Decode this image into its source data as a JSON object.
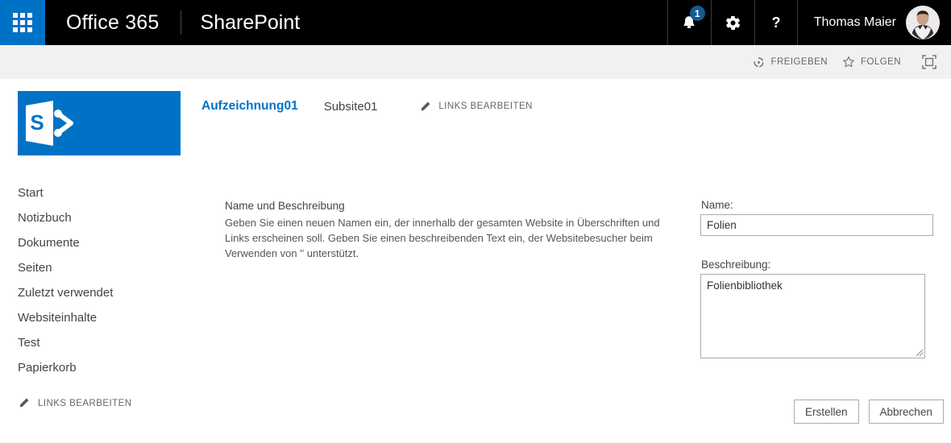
{
  "suitebar": {
    "waffle_label": "app-launcher",
    "brand": "Office 365",
    "app": "SharePoint",
    "notification_count": "1",
    "notification_icon": "bell-icon",
    "settings_icon": "gear-icon",
    "help_icon": "question-mark-icon",
    "user_name": "Thomas Maier",
    "background_color": "#000000",
    "waffle_color": "#0072C6"
  },
  "subbar": {
    "share_label": "FREIGEBEN",
    "follow_label": "FOLGEN",
    "share_icon": "share-circle-icon",
    "follow_icon": "star-icon",
    "focus_icon": "focus-on-content-icon",
    "background_color": "#F1F1F0"
  },
  "siteheader": {
    "logo_icon": "sharepoint-logo",
    "site_title": "Aufzeichnung01",
    "subsite_title": "Subsite01",
    "edit_links_label": "LINKS BEARBEITEN",
    "pencil_icon": "pencil-icon",
    "title_color": "#0072C6"
  },
  "sidebar": {
    "items": [
      {
        "label": "Start"
      },
      {
        "label": "Notizbuch"
      },
      {
        "label": "Dokumente"
      },
      {
        "label": "Seiten"
      },
      {
        "label": "Zuletzt verwendet"
      },
      {
        "label": "Websiteinhalte"
      },
      {
        "label": "Test"
      },
      {
        "label": "Papierkorb"
      }
    ],
    "edit_links_label": "LINKS BEARBEITEN",
    "pencil_icon": "pencil-icon"
  },
  "main": {
    "section_heading": "Name und Beschreibung",
    "section_description": "Geben Sie einen neuen Namen ein, der innerhalb der gesamten Website in Überschriften und Links erscheinen soll. Geben Sie einen beschreibenden Text ein, der Websitebesucher beim Verwenden von '' unterstützt.",
    "name_label": "Name:",
    "name_value": "Folien",
    "description_label": "Beschreibung:",
    "description_value": "Folienbibliothek",
    "create_button": "Erstellen",
    "cancel_button": "Abbrechen"
  }
}
